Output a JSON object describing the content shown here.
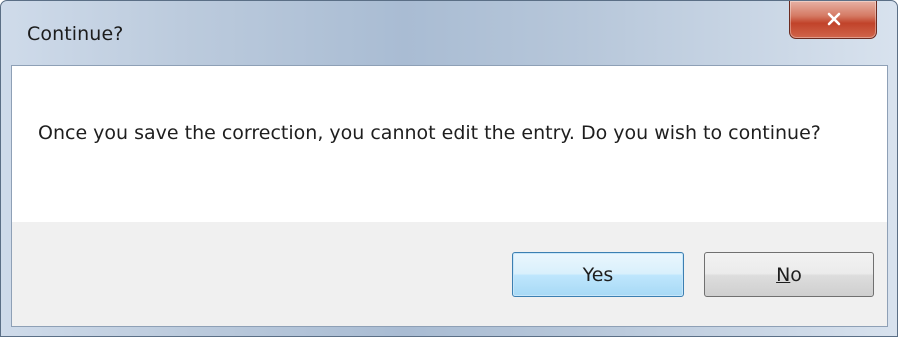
{
  "window": {
    "title": "Continue?"
  },
  "titlebar": {
    "close_icon": "close-x-icon"
  },
  "dialog": {
    "message": "Once you save the correction, you cannot edit the entry.  Do you wish to continue?"
  },
  "buttons": {
    "yes_label": "Yes",
    "no_label_mnemonic": "N",
    "no_label_rest": "o"
  },
  "colors": {
    "close_button": "#c1432a",
    "default_button_border": "#3c7fb1",
    "footer_background": "#f0f0f0"
  }
}
